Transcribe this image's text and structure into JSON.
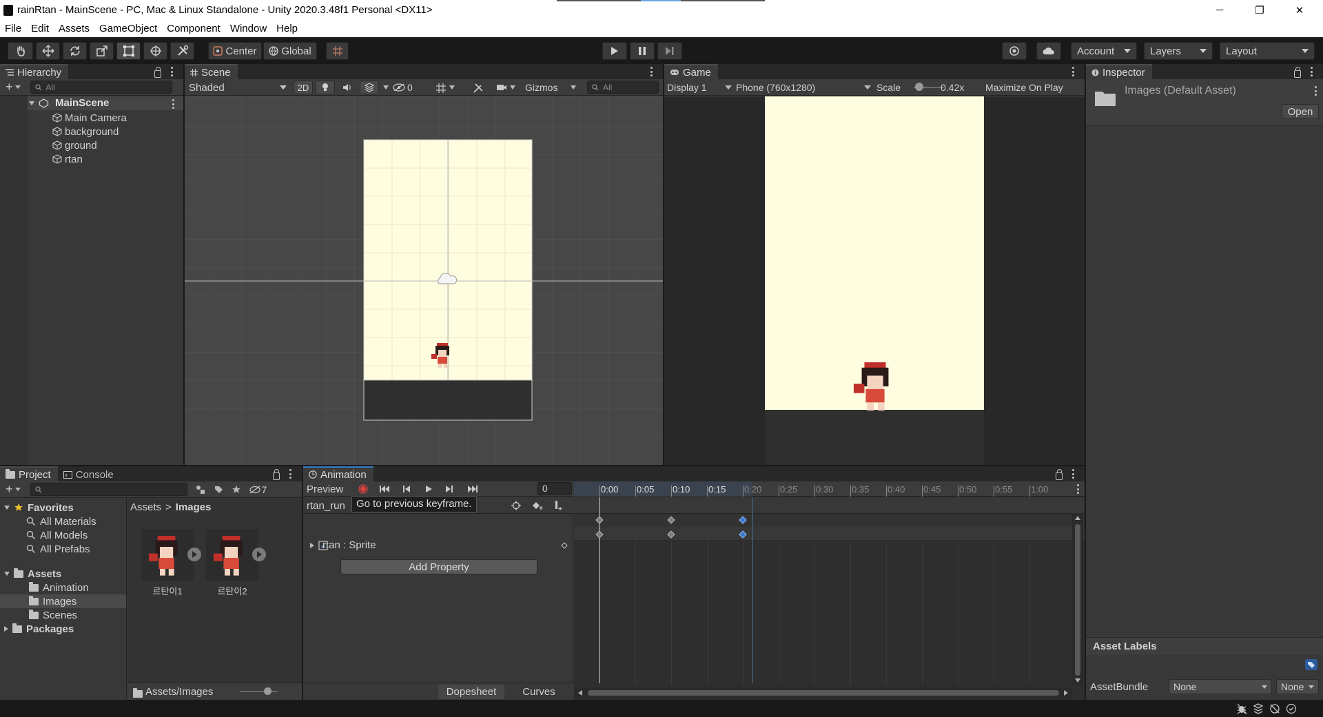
{
  "window": {
    "title": "rainRtan - MainScene - PC, Mac & Linux Standalone - Unity 2020.3.48f1 Personal <DX11>",
    "minimize": "─",
    "maximize": "❐",
    "close": "✕"
  },
  "menu": [
    "File",
    "Edit",
    "Assets",
    "GameObject",
    "Component",
    "Window",
    "Help"
  ],
  "toolbar": {
    "center": "Center",
    "global": "Global",
    "account": "Account",
    "layers": "Layers",
    "layout": "Layout"
  },
  "hierarchy": {
    "tab": "Hierarchy",
    "search_placeholder": "All",
    "scene": "MainScene",
    "items": [
      "Main Camera",
      "background",
      "ground",
      "rtan"
    ]
  },
  "scene": {
    "tab": "Scene",
    "shading": "Shaded",
    "mode2d": "2D",
    "hidden_count": "0",
    "gizmos": "Gizmos",
    "search_placeholder": "All"
  },
  "game": {
    "tab": "Game",
    "display": "Display 1",
    "resolution": "Phone (760x1280)",
    "scale_label": "Scale",
    "scale_value": "0.42x",
    "maximize": "Maximize On Play"
  },
  "inspector": {
    "tab": "Inspector",
    "asset": "Images (Default Asset)",
    "open": "Open",
    "asset_labels": "Asset Labels",
    "asset_bundle": "AssetBundle",
    "bundle_value": "None",
    "variant_value": "None"
  },
  "project": {
    "tab_project": "Project",
    "tab_console": "Console",
    "hidden_count": "7",
    "favorites": "Favorites",
    "fav_items": [
      "All Materials",
      "All Models",
      "All Prefabs"
    ],
    "assets": "Assets",
    "asset_items": [
      "Animation",
      "Images",
      "Scenes"
    ],
    "packages": "Packages",
    "breadcrumb_root": "Assets",
    "breadcrumb_sep": ">",
    "breadcrumb_current": "Images",
    "files": [
      "르탄이1",
      "르탄이2"
    ],
    "footer_path": "Assets/Images"
  },
  "animation": {
    "tab": "Animation",
    "preview": "Preview",
    "frame": "0",
    "clip": "rtan_run",
    "tooltip": "Go to previous keyframe.",
    "property": "rtan : Sprite",
    "add_property": "Add Property",
    "dopesheet": "Dopesheet",
    "curves": "Curves",
    "timeline": [
      "0:00",
      "0:05",
      "0:10",
      "0:15",
      "0:20",
      "0:25",
      "0:30",
      "0:35",
      "0:40",
      "0:45",
      "0:50",
      "0:55",
      "1:00"
    ]
  },
  "colors": {
    "accent": "#3a78c8",
    "scene_bg": "#474747",
    "game_sky": "#fffde0",
    "ground": "#2f2f2f"
  }
}
